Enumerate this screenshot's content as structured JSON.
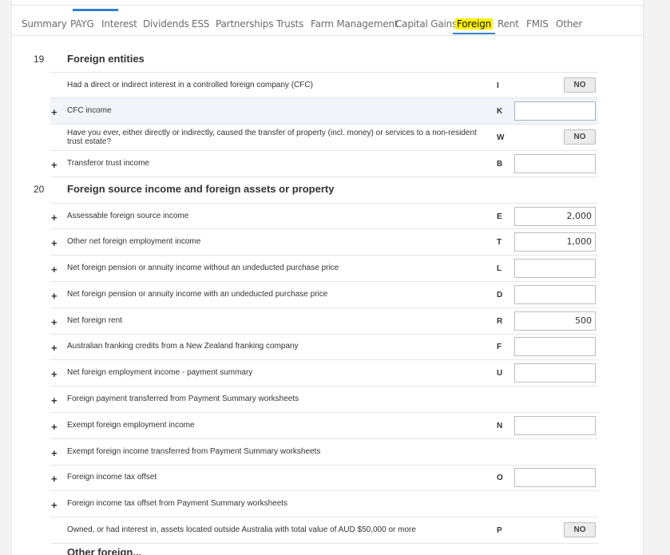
{
  "tabs": [
    {
      "label": "Summary"
    },
    {
      "label": "PAYG"
    },
    {
      "label": "Interest"
    },
    {
      "label": "Dividends"
    },
    {
      "label": "ESS"
    },
    {
      "label": "Partnerships"
    },
    {
      "label": "Trusts"
    },
    {
      "label": "Farm Management"
    },
    {
      "label": "Capital Gains"
    },
    {
      "label": "Foreign"
    },
    {
      "label": "Rent"
    },
    {
      "label": "FMIS"
    },
    {
      "label": "Other"
    }
  ],
  "active_tab": "Foreign",
  "sections": [
    {
      "number": "19",
      "title": "Foreign entities"
    },
    {
      "number": "20",
      "title": "Foreign source income and foreign assets or property"
    }
  ],
  "rows": [
    {
      "label": "Had a direct or indirect interest in a controlled foreign company (CFC)",
      "code": "I",
      "toggle": "NO"
    },
    {
      "label": "CFC income",
      "code": "K",
      "value": ""
    },
    {
      "label": "Have you ever, either directly or indirectly, caused the transfer of property (incl. money) or services to a non-resident trust estate?",
      "code": "W",
      "toggle": "NO"
    },
    {
      "label": "Transferor trust income",
      "code": "B",
      "value": ""
    },
    {
      "label": "Assessable foreign source income",
      "code": "E",
      "value": "2,000"
    },
    {
      "label": "Other net foreign employment income",
      "code": "T",
      "value": "1,000"
    },
    {
      "label": "Net foreign pension or annuity income without an undeducted purchase price",
      "code": "L",
      "value": ""
    },
    {
      "label": "Net foreign pension or annuity income with an undeducted purchase price",
      "code": "D",
      "value": ""
    },
    {
      "label": "Net foreign rent",
      "code": "R",
      "value": "500"
    },
    {
      "label": "Australian franking credits from a New Zealand franking company",
      "code": "F",
      "value": ""
    },
    {
      "label": "Net foreign employment income - payment summary",
      "code": "U",
      "value": ""
    },
    {
      "label": "Foreign payment transferred from Payment Summary worksheets"
    },
    {
      "label": "Exempt foreign employment income",
      "code": "N",
      "value": ""
    },
    {
      "label": "Exempt foreign income transferred from Payment Summary worksheets"
    },
    {
      "label": "Foreign income tax offset",
      "code": "O",
      "value": ""
    },
    {
      "label": "Foreign income tax offset from Payment Summary worksheets"
    },
    {
      "label": "Owned, or had interest in, assets located outside Australia with total value of AUD $50,000 or more",
      "code": "P",
      "toggle": "NO"
    }
  ],
  "bottom_section_title": "Other foreign...",
  "colors": {
    "accent": "#2e7fd2",
    "highlight": "#fff200"
  }
}
